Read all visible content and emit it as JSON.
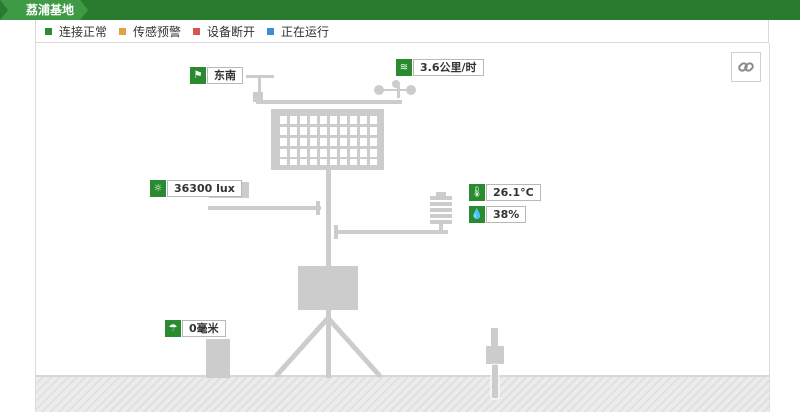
{
  "breadcrumb": {
    "site": "荔浦基地"
  },
  "legend": [
    {
      "label": "连接正常",
      "color": "#2e8b35"
    },
    {
      "label": "传感预警",
      "color": "#e5a040"
    },
    {
      "label": "设备断开",
      "color": "#d9534f"
    },
    {
      "label": "正在运行",
      "color": "#3a8fd9"
    }
  ],
  "sensors": {
    "wind_direction": {
      "icon": "wind-direction-icon",
      "value": "东南"
    },
    "wind_speed": {
      "icon": "wind-speed-icon",
      "value": "3.6公里/时"
    },
    "illuminance": {
      "icon": "sun-icon",
      "value": "36300 lux"
    },
    "temperature": {
      "icon": "thermometer-icon",
      "value": "26.1°C"
    },
    "humidity": {
      "icon": "humidity-drop-icon",
      "value": "38%"
    },
    "rainfall": {
      "icon": "umbrella-rain-icon",
      "value": "0毫米"
    }
  },
  "toolbar": {
    "link_icon": "link-icon"
  },
  "colors": {
    "brand_green": "#2a7a30",
    "sensor_green": "#2a8a2f",
    "equipment_gray": "#cccccc"
  }
}
